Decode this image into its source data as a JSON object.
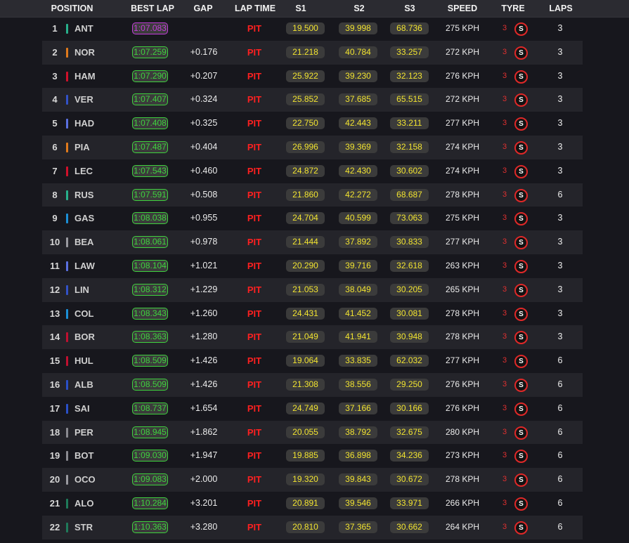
{
  "header": {
    "position": "POSITION",
    "best_lap": "BEST LAP",
    "gap": "GAP",
    "lap_time": "LAP TIME",
    "s1": "S1",
    "s2": "S2",
    "s3": "S3",
    "speed": "SPEED",
    "tyre": "TYRE",
    "laps": "LAPS"
  },
  "colors": {
    "personal_best": "#3ed23e",
    "fastest": "#c43cdc",
    "pit": "#ff2020",
    "sector": "#f1e330",
    "soft_tyre": "#e02828"
  },
  "rows": [
    {
      "pos": "1",
      "driver": "ANT",
      "team_color": "#27b08b",
      "best": "1:07.083",
      "fastest": true,
      "gap": "",
      "lap": "PIT",
      "s1": "19.500",
      "s2": "39.998",
      "s3": "68.736",
      "speed": "275 KPH",
      "tyre_age": "3",
      "tyre": "S",
      "laps": "3"
    },
    {
      "pos": "2",
      "driver": "NOR",
      "team_color": "#e07a1c",
      "best": "1:07.259",
      "gap": "+0.176",
      "lap": "PIT",
      "s1": "21.218",
      "s2": "40.784",
      "s3": "33.257",
      "speed": "272 KPH",
      "tyre_age": "3",
      "tyre": "S",
      "laps": "3"
    },
    {
      "pos": "3",
      "driver": "HAM",
      "team_color": "#d0102a",
      "best": "1:07.290",
      "gap": "+0.207",
      "lap": "PIT",
      "s1": "25.922",
      "s2": "39.230",
      "s3": "32.123",
      "speed": "276 KPH",
      "tyre_age": "3",
      "tyre": "S",
      "laps": "3"
    },
    {
      "pos": "4",
      "driver": "VER",
      "team_color": "#3252c8",
      "best": "1:07.407",
      "gap": "+0.324",
      "lap": "PIT",
      "s1": "25.852",
      "s2": "37.685",
      "s3": "65.515",
      "speed": "272 KPH",
      "tyre_age": "3",
      "tyre": "S",
      "laps": "3"
    },
    {
      "pos": "5",
      "driver": "HAD",
      "team_color": "#5a70e0",
      "best": "1:07.408",
      "gap": "+0.325",
      "lap": "PIT",
      "s1": "22.750",
      "s2": "42.443",
      "s3": "33.211",
      "speed": "277 KPH",
      "tyre_age": "3",
      "tyre": "S",
      "laps": "3"
    },
    {
      "pos": "6",
      "driver": "PIA",
      "team_color": "#e07a1c",
      "best": "1:07.487",
      "gap": "+0.404",
      "lap": "PIT",
      "s1": "26.996",
      "s2": "39.369",
      "s3": "32.158",
      "speed": "274 KPH",
      "tyre_age": "3",
      "tyre": "S",
      "laps": "3"
    },
    {
      "pos": "7",
      "driver": "LEC",
      "team_color": "#d0102a",
      "best": "1:07.543",
      "gap": "+0.460",
      "lap": "PIT",
      "s1": "24.872",
      "s2": "42.430",
      "s3": "30.602",
      "speed": "274 KPH",
      "tyre_age": "3",
      "tyre": "S",
      "laps": "3"
    },
    {
      "pos": "8",
      "driver": "RUS",
      "team_color": "#27b08b",
      "best": "1:07.591",
      "gap": "+0.508",
      "lap": "PIT",
      "s1": "21.860",
      "s2": "42.272",
      "s3": "68.687",
      "speed": "278 KPH",
      "tyre_age": "3",
      "tyre": "S",
      "laps": "6"
    },
    {
      "pos": "9",
      "driver": "GAS",
      "team_color": "#1b8fd6",
      "best": "1:08.038",
      "gap": "+0.955",
      "lap": "PIT",
      "s1": "24.704",
      "s2": "40.599",
      "s3": "73.063",
      "speed": "275 KPH",
      "tyre_age": "3",
      "tyre": "S",
      "laps": "3"
    },
    {
      "pos": "10",
      "driver": "BEA",
      "team_color": "#9a9aa0",
      "best": "1:08.061",
      "gap": "+0.978",
      "lap": "PIT",
      "s1": "21.444",
      "s2": "37.892",
      "s3": "30.833",
      "speed": "277 KPH",
      "tyre_age": "3",
      "tyre": "S",
      "laps": "3"
    },
    {
      "pos": "11",
      "driver": "LAW",
      "team_color": "#5a70e0",
      "best": "1:08.104",
      "gap": "+1.021",
      "lap": "PIT",
      "s1": "20.290",
      "s2": "39.716",
      "s3": "32.618",
      "speed": "263 KPH",
      "tyre_age": "3",
      "tyre": "S",
      "laps": "3"
    },
    {
      "pos": "12",
      "driver": "LIN",
      "team_color": "#3252c8",
      "best": "1:08.312",
      "gap": "+1.229",
      "lap": "PIT",
      "s1": "21.053",
      "s2": "38.049",
      "s3": "30.205",
      "speed": "265 KPH",
      "tyre_age": "3",
      "tyre": "S",
      "laps": "3"
    },
    {
      "pos": "13",
      "driver": "COL",
      "team_color": "#1b8fd6",
      "best": "1:08.343",
      "gap": "+1.260",
      "lap": "PIT",
      "s1": "24.431",
      "s2": "41.452",
      "s3": "30.081",
      "speed": "278 KPH",
      "tyre_age": "3",
      "tyre": "S",
      "laps": "3"
    },
    {
      "pos": "14",
      "driver": "BOR",
      "team_color": "#c01030",
      "best": "1:08.363",
      "gap": "+1.280",
      "lap": "PIT",
      "s1": "21.049",
      "s2": "41.941",
      "s3": "30.948",
      "speed": "278 KPH",
      "tyre_age": "3",
      "tyre": "S",
      "laps": "3"
    },
    {
      "pos": "15",
      "driver": "HUL",
      "team_color": "#c01030",
      "best": "1:08.509",
      "gap": "+1.426",
      "lap": "PIT",
      "s1": "19.064",
      "s2": "33.835",
      "s3": "62.032",
      "speed": "277 KPH",
      "tyre_age": "3",
      "tyre": "S",
      "laps": "6"
    },
    {
      "pos": "16",
      "driver": "ALB",
      "team_color": "#2a50c8",
      "best": "1:08.509",
      "gap": "+1.426",
      "lap": "PIT",
      "s1": "21.308",
      "s2": "38.556",
      "s3": "29.250",
      "speed": "276 KPH",
      "tyre_age": "3",
      "tyre": "S",
      "laps": "6"
    },
    {
      "pos": "17",
      "driver": "SAI",
      "team_color": "#2a50c8",
      "best": "1:08.737",
      "gap": "+1.654",
      "lap": "PIT",
      "s1": "24.749",
      "s2": "37.166",
      "s3": "30.166",
      "speed": "276 KPH",
      "tyre_age": "3",
      "tyre": "S",
      "laps": "6"
    },
    {
      "pos": "18",
      "driver": "PER",
      "team_color": "#8a8a90",
      "best": "1:08.945",
      "gap": "+1.862",
      "lap": "PIT",
      "s1": "20.055",
      "s2": "38.792",
      "s3": "32.675",
      "speed": "280 KPH",
      "tyre_age": "3",
      "tyre": "S",
      "laps": "6"
    },
    {
      "pos": "19",
      "driver": "BOT",
      "team_color": "#8a8a90",
      "best": "1:09.030",
      "gap": "+1.947",
      "lap": "PIT",
      "s1": "19.885",
      "s2": "36.898",
      "s3": "34.236",
      "speed": "273 KPH",
      "tyre_age": "3",
      "tyre": "S",
      "laps": "6"
    },
    {
      "pos": "20",
      "driver": "OCO",
      "team_color": "#9a9aa0",
      "best": "1:09.083",
      "gap": "+2.000",
      "lap": "PIT",
      "s1": "19.320",
      "s2": "39.843",
      "s3": "30.672",
      "speed": "278 KPH",
      "tyre_age": "3",
      "tyre": "S",
      "laps": "6"
    },
    {
      "pos": "21",
      "driver": "ALO",
      "team_color": "#1f7a5a",
      "best": "1:10.284",
      "gap": "+3.201",
      "lap": "PIT",
      "s1": "20.891",
      "s2": "39.546",
      "s3": "33.971",
      "speed": "266 KPH",
      "tyre_age": "3",
      "tyre": "S",
      "laps": "6"
    },
    {
      "pos": "22",
      "driver": "STR",
      "team_color": "#1f7a5a",
      "best": "1:10.363",
      "gap": "+3.280",
      "lap": "PIT",
      "s1": "20.810",
      "s2": "37.365",
      "s3": "30.662",
      "speed": "264 KPH",
      "tyre_age": "3",
      "tyre": "S",
      "laps": "6"
    }
  ]
}
